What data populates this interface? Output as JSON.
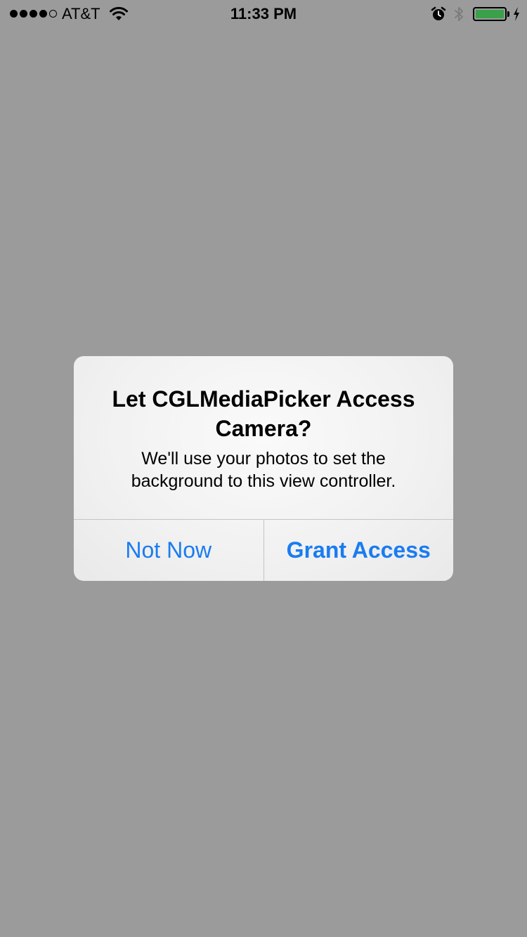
{
  "status_bar": {
    "signal_full_count": 4,
    "signal_total": 5,
    "carrier": "AT&T",
    "time": "11:33 PM",
    "battery_level": 1.0,
    "battery_color": "#3aa04a",
    "icons": [
      "signal-dots-icon",
      "wifi-icon",
      "alarm-icon",
      "bluetooth-icon",
      "battery-icon",
      "charging-bolt-icon"
    ]
  },
  "alert": {
    "title": "Let CGLMediaPicker Access Camera?",
    "message": "We'll use your photos to set the background to this view controller.",
    "buttons": {
      "cancel": "Not Now",
      "confirm": "Grant Access"
    },
    "button_color": "#1a7cf0"
  },
  "background_color": "#9b9b9b"
}
